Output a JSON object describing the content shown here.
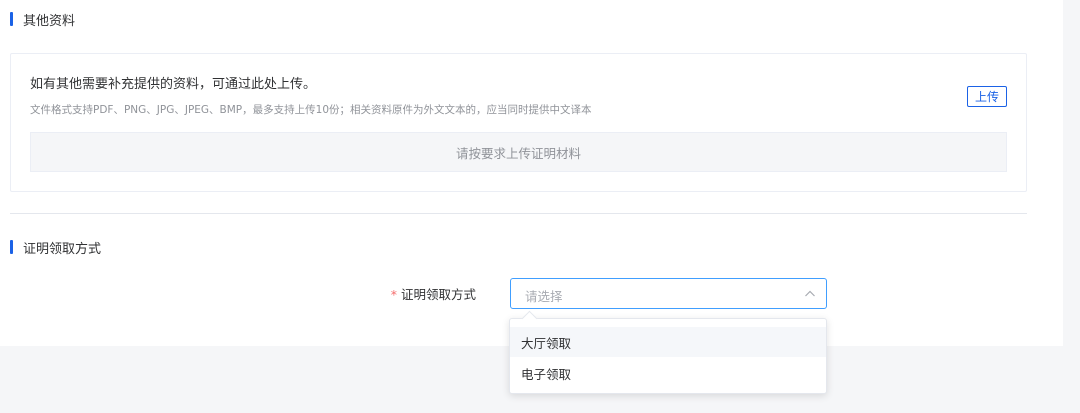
{
  "other_materials": {
    "section_title": "其他资料",
    "heading": "如有其他需要补充提供的资料，可通过此处上传。",
    "hint": "文件格式支持PDF、PNG、JPG、JPEG、BMP，最多支持上传10份；相关资料原件为外文文本的，应当同时提供中文译本",
    "upload_label": "上传",
    "upload_placeholder": "请按要求上传证明材料"
  },
  "collection": {
    "section_title": "证明领取方式",
    "required_mark": "*",
    "field_label": "证明领取方式",
    "select_placeholder": "请选择",
    "options": [
      "大厅领取",
      "电子领取"
    ]
  },
  "colors": {
    "accent": "#1b62e6",
    "required": "#f56c6c",
    "border_focus": "#409eff"
  },
  "icons": {
    "select_arrow": "chevron-up-icon"
  }
}
